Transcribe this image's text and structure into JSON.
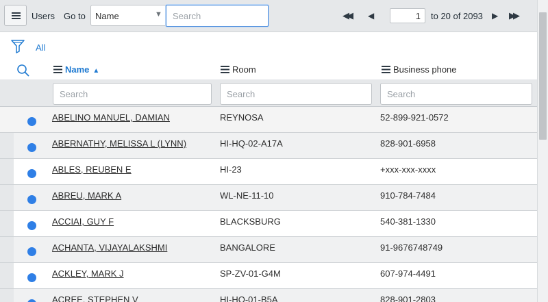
{
  "toolbar": {
    "list_title": "Users",
    "goto_label": "Go to",
    "field_selected": "Name",
    "search_placeholder": "Search",
    "page_input": "1",
    "range_text": "to 20 of 2093"
  },
  "filter": {
    "all_label": "All"
  },
  "columns": [
    {
      "label": "Name",
      "sorted": "ascending"
    },
    {
      "label": "Room"
    },
    {
      "label": "Business phone"
    }
  ],
  "column_search_placeholders": [
    "Search",
    "Search",
    "Search"
  ],
  "rows": [
    {
      "name": "ABELINO MANUEL, DAMIAN",
      "room": "REYNOSA",
      "phone": "52-899-921-0572"
    },
    {
      "name": "ABERNATHY, MELISSA L (LYNN)",
      "room": "HI-HQ-02-A17A",
      "phone": "828-901-6958"
    },
    {
      "name": "ABLES, REUBEN E",
      "room": "HI-23",
      "phone": "+xxx-xxx-xxxx"
    },
    {
      "name": "ABREU, MARK A",
      "room": "WL-NE-11-10",
      "phone": "910-784-7484"
    },
    {
      "name": "ACCIAI, GUY F",
      "room": "BLACKSBURG",
      "phone": "540-381-1330"
    },
    {
      "name": "ACHANTA, VIJAYALAKSHMI",
      "room": "BANGALORE",
      "phone": "91-9676748749"
    },
    {
      "name": "ACKLEY, MARK J",
      "room": "SP-ZV-01-G4M",
      "phone": "607-974-4491"
    },
    {
      "name": "ACREE, STEPHEN V",
      "room": "HI-HQ-01-B5A",
      "phone": "828-901-2803"
    }
  ],
  "colors": {
    "accent": "#1f7ad1",
    "status_dot": "#2f7fe6"
  }
}
